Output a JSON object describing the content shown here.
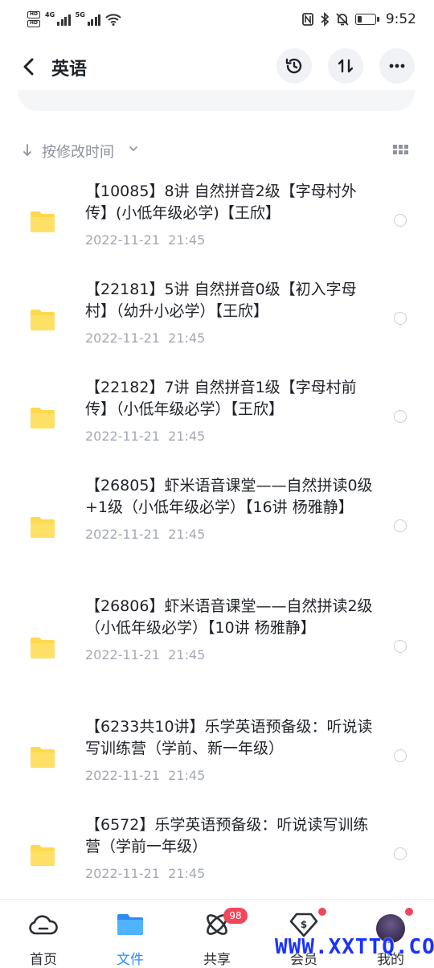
{
  "status_bar": {
    "sim_labels": [
      "HD",
      "HD"
    ],
    "network_1": "4G",
    "network_2": "5G",
    "time": "9:52",
    "battery_level": 0.3
  },
  "header": {
    "title": "英语",
    "icons": [
      "back-arrow",
      "history",
      "sort-swap",
      "more"
    ]
  },
  "sort_bar": {
    "label": "按修改时间"
  },
  "files": [
    {
      "name": "【10085】8讲 自然拼音2级【字母村外传】(小低年级必学)【王欣】",
      "date": "2022-11-21  21:45"
    },
    {
      "name": "【22181】5讲 自然拼音0级【初入字母村】（幼升小必学）【王欣】",
      "date": "2022-11-21  21:45"
    },
    {
      "name": "【22182】7讲 自然拼音1级【字母村前传】（小低年级必学）【王欣】",
      "date": "2022-11-21  21:45"
    },
    {
      "name": "【26805】虾米语音课堂——自然拼读0级+1级（小低年级必学）【16讲 杨雅静】",
      "date": "2022-11-21  21:45"
    },
    {
      "name": "【26806】虾米语音课堂——自然拼读2级（小低年级必学）【10讲 杨雅静】",
      "date": "2022-11-21  21:45"
    },
    {
      "name": "【6233共10讲】乐学英语预备级：听说读写训练营（学前、新一年级）",
      "date": "2022-11-21  21:45"
    },
    {
      "name": "【6572】乐学英语预备级：听说读写训练营（学前一年级）",
      "date": "2022-11-21  21:45"
    }
  ],
  "tab_bar": {
    "home": "首页",
    "files": "文件",
    "share": "共享",
    "share_badge": "98",
    "member": "会员",
    "me": "我的"
  },
  "colors": {
    "accent": "#2b8cf6",
    "folder": "#ffd84d",
    "badge": "#f2465a"
  },
  "watermark": "WWW.XXTTQ.COM"
}
